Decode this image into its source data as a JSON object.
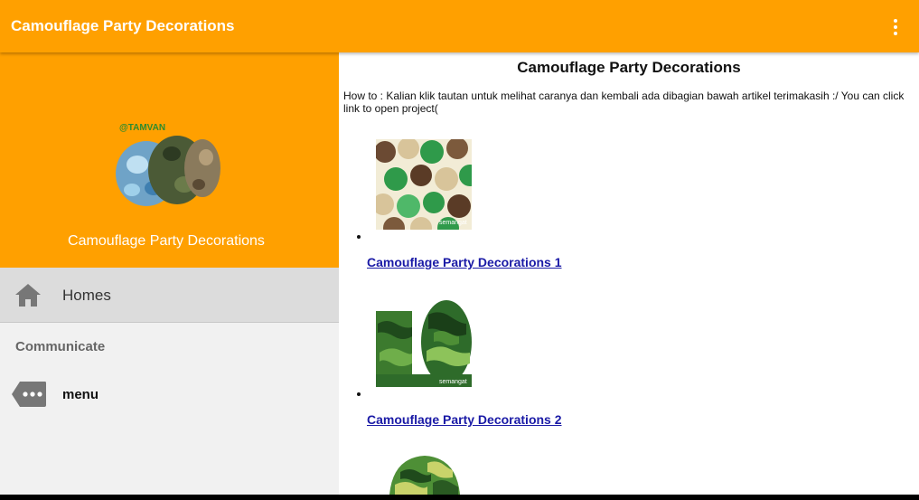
{
  "app_bar": {
    "title": "Camouflage Party Decorations",
    "overflow_icon": "more-vert-icon"
  },
  "drawer": {
    "header": {
      "background": "#FFA000",
      "image_watermark": "@TAMVAN",
      "title": "Camouflage Party Decorations"
    },
    "items": [
      {
        "icon": "home-icon",
        "label": "Homes",
        "selected": true
      }
    ],
    "section_label": "Communicate",
    "section_items": [
      {
        "icon": "more-tag-icon",
        "label": "menu"
      }
    ]
  },
  "content": {
    "title": "Camouflage Party Decorations",
    "intro": "How to : Kalian klik tautan untuk melihat caranya dan kembali ada dibagian bawah artikel terimakasih :/ You can click link to open project(",
    "items": [
      {
        "link": "Camouflage Party Decorations 1",
        "watermark": "semangat"
      },
      {
        "link": "Camouflage Party Decorations 2",
        "watermark": "semangat"
      }
    ]
  },
  "colors": {
    "accent": "#FFA000",
    "link": "#1a1aa6",
    "drawer_bg": "#F1F1F1",
    "selected_bg": "#DCDCDC"
  }
}
